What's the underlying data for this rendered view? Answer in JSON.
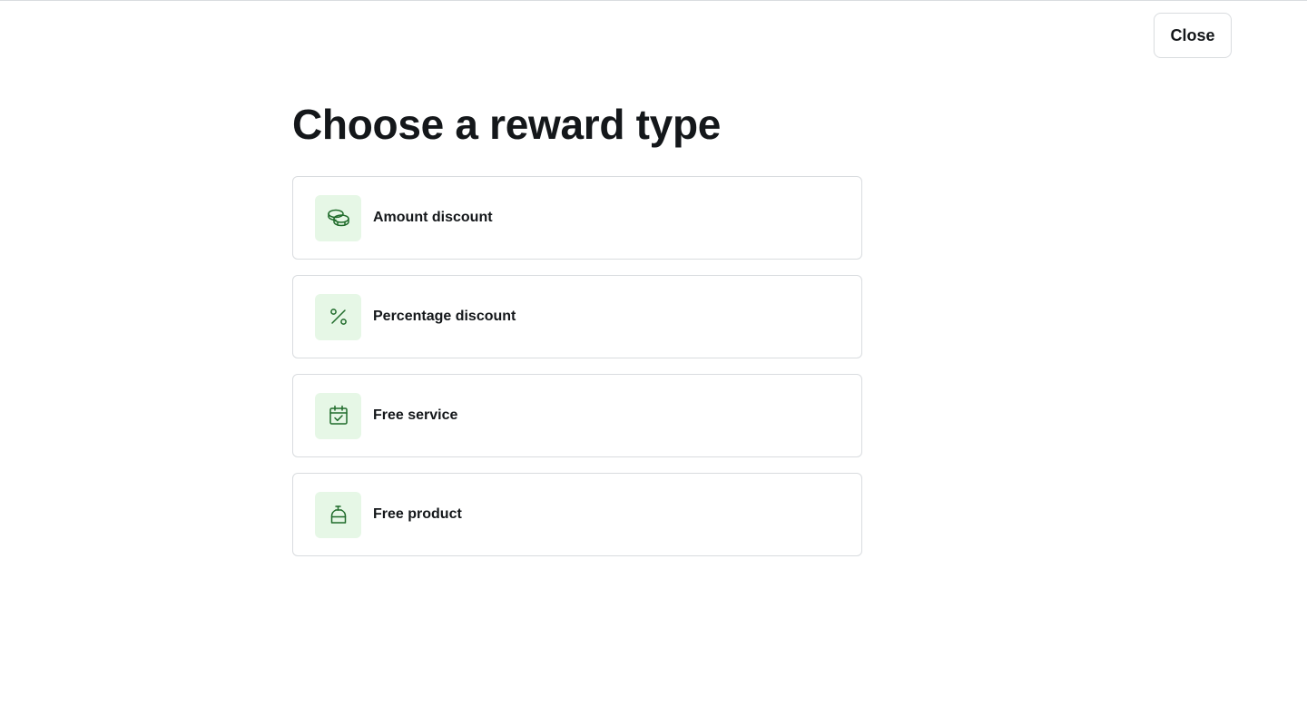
{
  "header": {
    "close_label": "Close"
  },
  "main": {
    "title": "Choose a reward type",
    "options": [
      {
        "label": "Amount discount",
        "icon": "coins-icon"
      },
      {
        "label": "Percentage discount",
        "icon": "percent-icon"
      },
      {
        "label": "Free service",
        "icon": "calendar-check-icon"
      },
      {
        "label": "Free product",
        "icon": "bottle-icon"
      }
    ]
  },
  "colors": {
    "icon_tile_bg": "#e6f7e6",
    "icon_stroke": "#1f6b2a",
    "border": "#d9dcdf",
    "text": "#14171a"
  }
}
